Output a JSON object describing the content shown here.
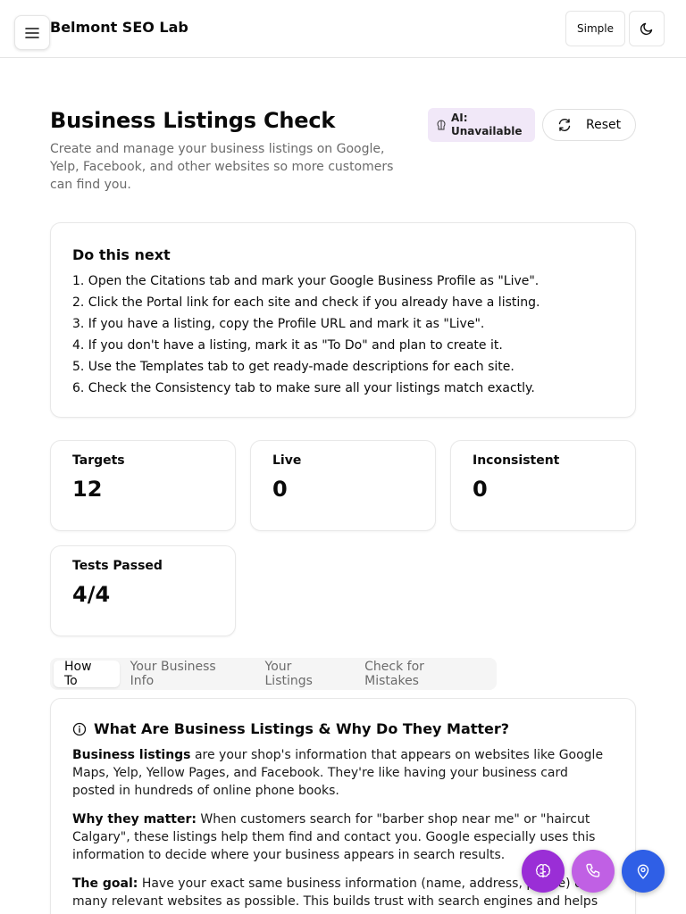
{
  "app": {
    "title": "Belmont SEO Lab",
    "mode_label": "Simple"
  },
  "icons": {
    "menu": "menu-icon",
    "theme": "moon-icon",
    "ai": "brain-icon",
    "reset": "refresh-icon",
    "info": "info-icon",
    "fab1": "brain-icon",
    "fab2": "phone-icon",
    "fab3": "map-pin-icon"
  },
  "colors": {
    "ai_badge_bg": "#f1e8f8",
    "fab_brain": "#9a2ed6",
    "fab_phone": "#c060e4",
    "fab_location": "#2f5fe6"
  },
  "header": {
    "title": "Business Listings Check",
    "subtitle": "Create and manage your business listings on Google, Yelp, Facebook, and other websites so more customers can find you.",
    "ai_badge_line1": "AI:",
    "ai_badge_line2": "Unavailable",
    "reset_label": "Reset"
  },
  "next": {
    "title": "Do this next",
    "steps": [
      "1. Open the Citations tab and mark your Google Business Profile as \"Live\".",
      "2. Click the Portal link for each site and check if you already have a listing.",
      "3. If you have a listing, copy the Profile URL and mark it as \"Live\".",
      "4. If you don't have a listing, mark it as \"To Do\" and plan to create it.",
      "5. Use the Templates tab to get ready-made descriptions for each site.",
      "6. Check the Consistency tab to make sure all your listings match exactly."
    ]
  },
  "stats": [
    {
      "label": "Targets",
      "value": "12"
    },
    {
      "label": "Live",
      "value": "0"
    },
    {
      "label": "Inconsistent",
      "value": "0"
    },
    {
      "label": "Tests Passed",
      "value": "4/4"
    }
  ],
  "tabs": [
    {
      "label": "How To",
      "active": true
    },
    {
      "label": "Your Business Info",
      "active": false
    },
    {
      "label": "Your Listings",
      "active": false
    },
    {
      "label": "Check for Mistakes",
      "active": false
    }
  ],
  "info": {
    "heading": "What Are Business Listings & Why Do They Matter?",
    "p1_bold": "Business listings",
    "p1_text": " are your shop's information that appears on websites like Google Maps, Yelp, Yellow Pages, and Facebook. They're like having your business card posted in hundreds of online phone books.",
    "p2_bold": "Why they matter:",
    "p2_text": " When customers search for \"barber shop near me\" or \"haircut Calgary\", these listings help them find and contact you. Google especially uses this information to decide where your business appears in search results.",
    "p3_bold": "The goal:",
    "p3_text": " Have your exact same business information (name, address, phone) on as many relevant websites as possible. This builds trust with search engines and helps"
  }
}
